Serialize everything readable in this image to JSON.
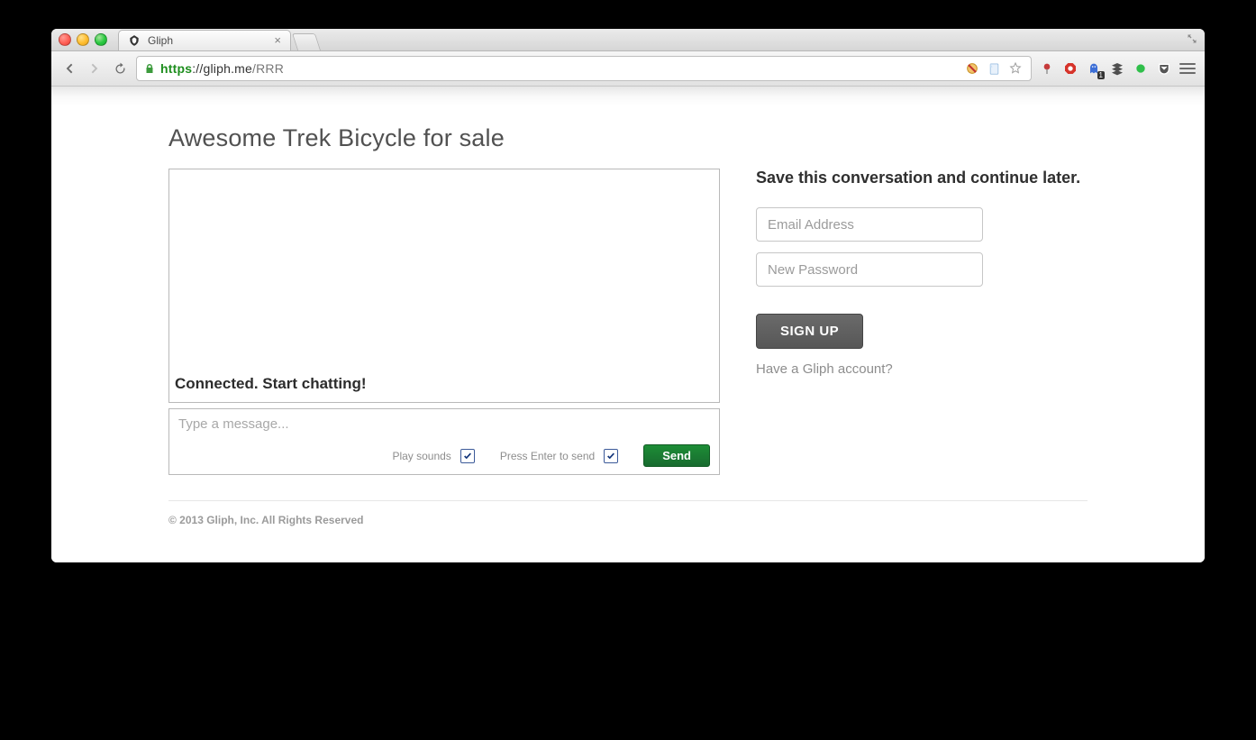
{
  "browser": {
    "tab_title": "Gliph",
    "url_scheme": "https",
    "url_host": "://gliph.me",
    "url_path": "/RRR"
  },
  "page": {
    "title": "Awesome Trek Bicycle for sale",
    "chat_status": "Connected. Start chatting!",
    "message_placeholder": "Type a message...",
    "play_sounds_label": "Play sounds",
    "press_enter_label": "Press Enter to send",
    "send_label": "Send"
  },
  "sidebar": {
    "heading": "Save this conversation and continue later.",
    "email_placeholder": "Email Address",
    "password_placeholder": "New Password",
    "signup_label": "SIGN UP",
    "have_account_label": "Have a Gliph account?"
  },
  "footer": {
    "copyright": "© 2013 Gliph, Inc. All Rights Reserved"
  }
}
